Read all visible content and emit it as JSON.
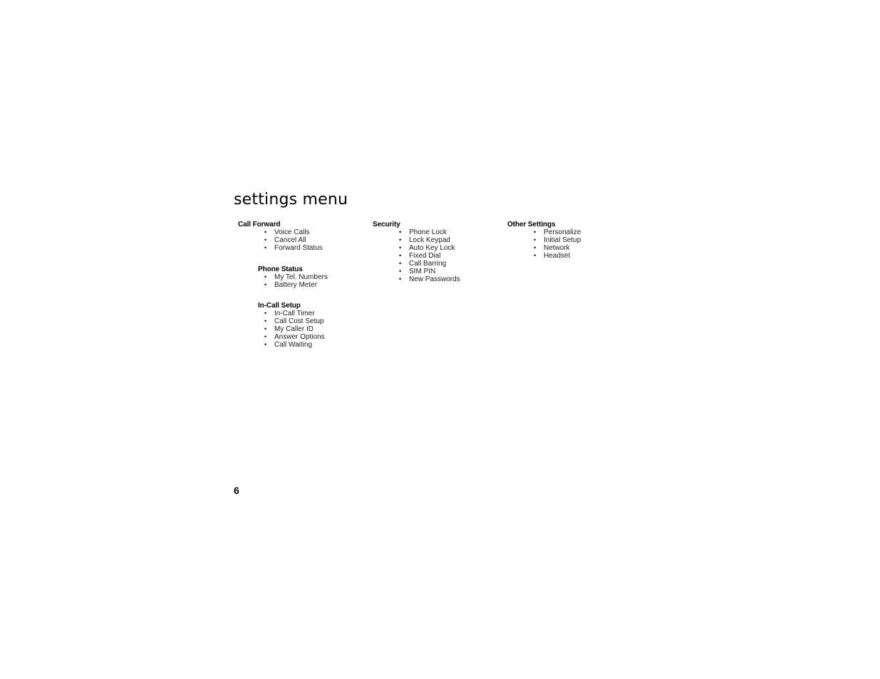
{
  "page": {
    "title": "settings menu",
    "page_number": "6"
  },
  "groups": [
    {
      "heading": "Call Forward",
      "items": [
        "Voice Calls",
        "Cancel All",
        "Forward Status"
      ]
    },
    {
      "heading": "Phone Status",
      "items": [
        "My Tel. Numbers",
        "Battery Meter"
      ]
    },
    {
      "heading": "In-Call Setup",
      "items": [
        "In-Call Timer",
        "Call Cost Setup",
        "My Caller ID",
        "Answer Options",
        "Call Waiting"
      ]
    },
    {
      "heading": "Security",
      "items": [
        "Phone Lock",
        "Lock Keypad",
        "Auto Key Lock",
        "Fixed Dial",
        "Call Barring",
        "SIM PIN",
        "New Passwords"
      ]
    },
    {
      "heading": "Other Settings",
      "items": [
        "Personalize",
        "Initial Setup",
        "Network",
        "Headset"
      ]
    }
  ],
  "bullet_glyph": "•"
}
